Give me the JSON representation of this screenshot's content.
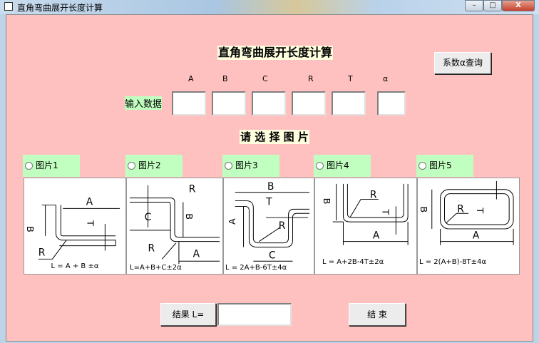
{
  "window": {
    "title": "直角弯曲展开长度计算",
    "minimize": "–",
    "maximize": "□",
    "close": "X"
  },
  "header": {
    "title": "直角弯曲展开长度计算",
    "coef_button": "系数α查询"
  },
  "inputs": {
    "label": "输入数据",
    "fields": [
      {
        "name": "A",
        "value": ""
      },
      {
        "name": "B",
        "value": ""
      },
      {
        "name": "C",
        "value": ""
      },
      {
        "name": "R",
        "value": ""
      },
      {
        "name": "T",
        "value": ""
      },
      {
        "name": "α",
        "value": ""
      }
    ]
  },
  "select_title": "请 选 择 图 片",
  "pictures": [
    {
      "label": "图片1",
      "formula": "L = A + B ±α",
      "selected": false
    },
    {
      "label": "图片2",
      "formula": "L=A+B+C±2α",
      "selected": false
    },
    {
      "label": "图片3",
      "formula": "L = 2A+B-6T±4α",
      "selected": false
    },
    {
      "label": "图片4",
      "formula": "L = A+2B-4T±2α",
      "selected": false
    },
    {
      "label": "图片5",
      "formula": "L = 2(A+B)-8T±4α",
      "selected": false
    }
  ],
  "result": {
    "label": "结果 L=",
    "value": ""
  },
  "end_button": "结 束",
  "dims": {
    "A": "A",
    "B": "B",
    "C": "C",
    "R": "R",
    "T": "T"
  }
}
